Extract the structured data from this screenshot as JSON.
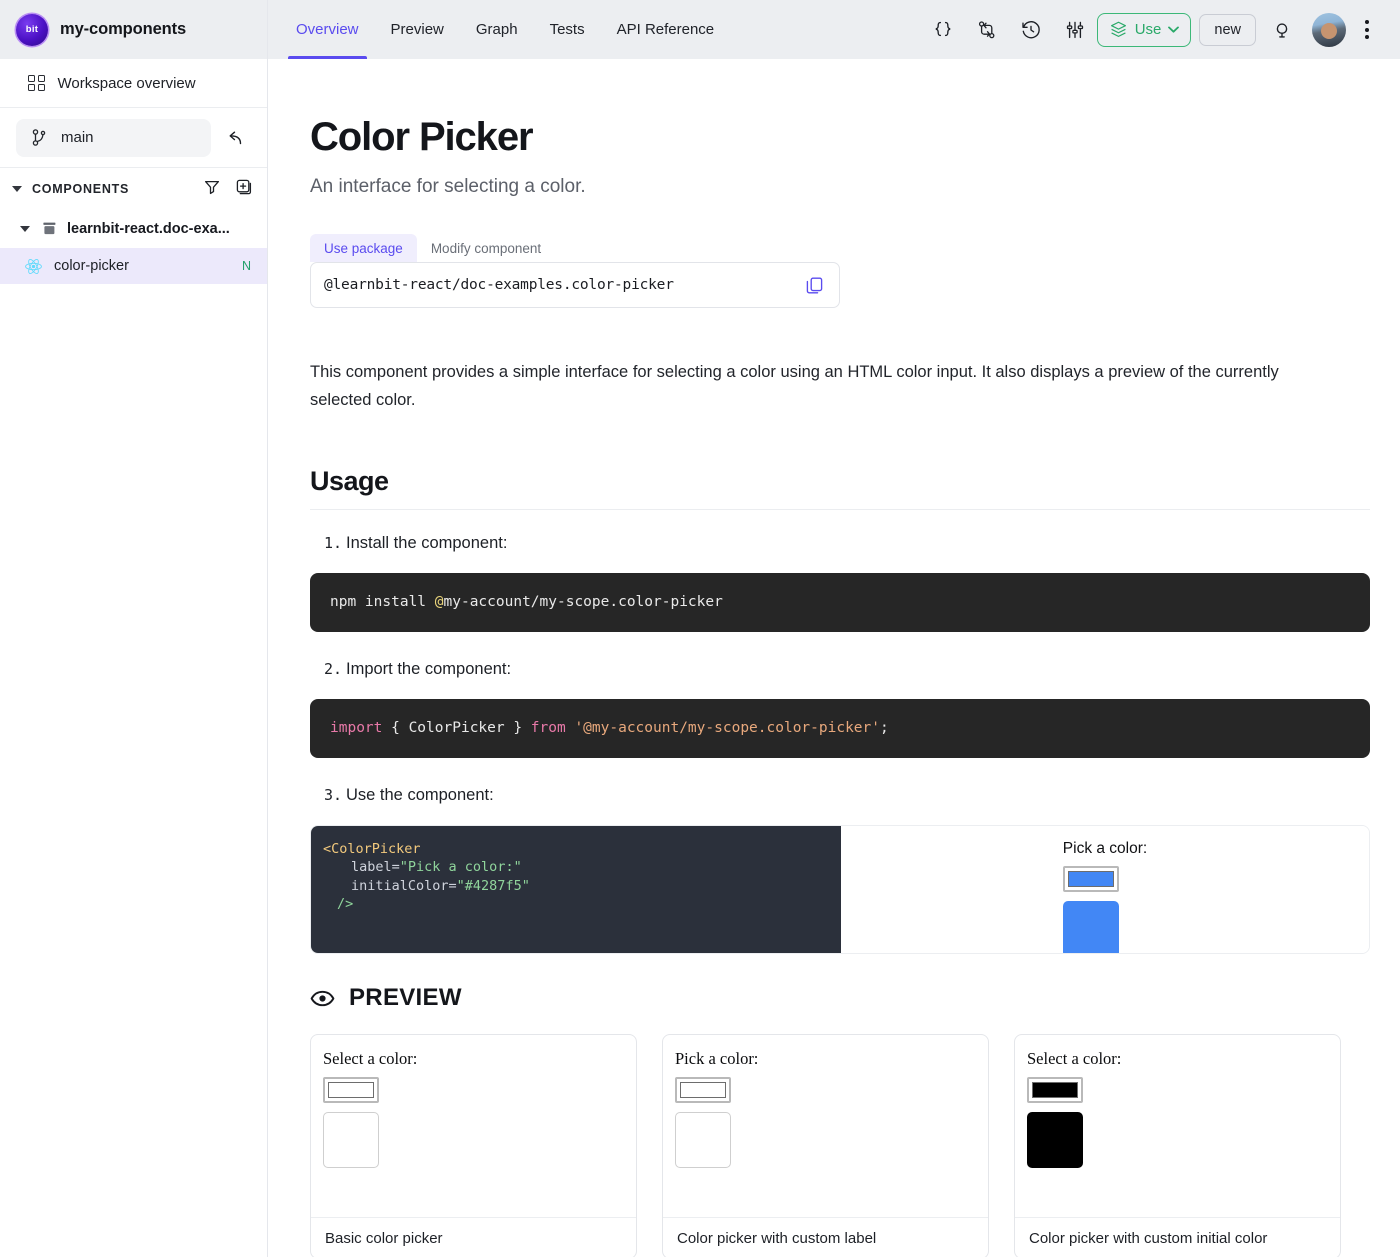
{
  "workspace": {
    "logo_text": "bit",
    "name": "my-components",
    "overview_label": "Workspace overview",
    "branch": "main",
    "components_label": "COMPONENTS",
    "scope": "learnbit-react.doc-exa...",
    "component": "color-picker",
    "component_status": "N"
  },
  "topbar": {
    "tabs": [
      {
        "label": "Overview",
        "active": true
      },
      {
        "label": "Preview",
        "active": false
      },
      {
        "label": "Graph",
        "active": false
      },
      {
        "label": "Tests",
        "active": false
      },
      {
        "label": "API Reference",
        "active": false
      }
    ],
    "icons": [
      "code-braces-icon",
      "compare-icon",
      "history-icon",
      "sliders-icon"
    ],
    "use_label": "Use",
    "new_label": "new",
    "accent_color": "#5a4bef",
    "use_color": "#2aa969"
  },
  "page": {
    "title": "Color Picker",
    "subtitle": "An interface for selecting a color.",
    "package_tabs": [
      {
        "label": "Use package",
        "active": true
      },
      {
        "label": "Modify component",
        "active": false
      }
    ],
    "package_name": "@learnbit-react/doc-examples.color-picker",
    "description": "This component provides a simple interface for selecting a color using an HTML color input. It also displays a preview of the currently selected color."
  },
  "usage": {
    "heading": "Usage",
    "steps": [
      {
        "num": "1.",
        "text": "Install the component:"
      },
      {
        "num": "2.",
        "text": "Import the component:"
      },
      {
        "num": "3.",
        "text": "Use the component:"
      }
    ],
    "install_cmd": {
      "plain1": "npm install ",
      "at": "@",
      "plain2": "my-account/my-scope.color-picker"
    },
    "import_code": {
      "kw_import": "import",
      "braces": " { ColorPicker } ",
      "kw_from": "from",
      "module": " '@my-account/my-scope.color-picker'",
      "semi": ";"
    },
    "jsx_code": {
      "line1": "<ColorPicker",
      "line2_attr": "label=",
      "line2_val": "\"Pick a color:\"",
      "line3_attr": "initialColor=",
      "line3_val": "\"#4287f5\"",
      "line4": "/>"
    }
  },
  "live_demo": {
    "label": "Pick a color:",
    "color": "#4287f5"
  },
  "preview": {
    "heading": "PREVIEW",
    "cards": [
      {
        "label": "Select a color:",
        "color": "",
        "caption": "Basic color picker"
      },
      {
        "label": "Pick a color:",
        "color": "",
        "caption": "Color picker with custom label"
      },
      {
        "label": "Select a color:",
        "color": "#000000",
        "caption": "Color picker with custom initial color"
      }
    ]
  }
}
